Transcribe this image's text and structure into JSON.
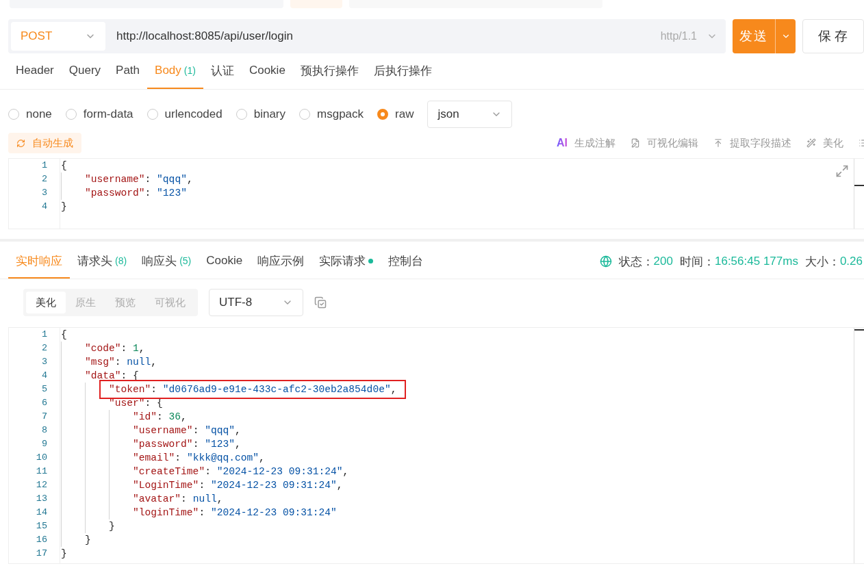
{
  "request": {
    "method": "POST",
    "url": "http://localhost:8085/api/user/login",
    "protocol": "http/1.1",
    "send": "发送",
    "save": "保 存"
  },
  "request_tabs": [
    {
      "label": "Header",
      "selected": false
    },
    {
      "label": "Query",
      "selected": false
    },
    {
      "label": "Path",
      "selected": false
    },
    {
      "label": "Body",
      "count": "(1)",
      "selected": true
    },
    {
      "label": "认证",
      "selected": false
    },
    {
      "label": "Cookie",
      "selected": false
    },
    {
      "label": "预执行操作",
      "selected": false
    },
    {
      "label": "后执行操作",
      "selected": false
    }
  ],
  "body_types": [
    {
      "label": "none",
      "selected": false
    },
    {
      "label": "form-data",
      "selected": false
    },
    {
      "label": "urlencoded",
      "selected": false
    },
    {
      "label": "binary",
      "selected": false
    },
    {
      "label": "msgpack",
      "selected": false
    },
    {
      "label": "raw",
      "selected": true
    }
  ],
  "format": "json",
  "auto_button": "自动生成",
  "body_tools": [
    {
      "kind": "ai",
      "badge": "AI",
      "label": "生成注解"
    },
    {
      "kind": "edit",
      "label": "可视化编辑"
    },
    {
      "kind": "extract",
      "label": "提取字段描述"
    },
    {
      "kind": "beautify",
      "label": "美化"
    }
  ],
  "request_body": [
    {
      "no": "1",
      "code": "{"
    },
    {
      "no": "2",
      "code": "    \"username\": \"qqq\","
    },
    {
      "no": "3",
      "code": "    \"password\": \"123\""
    },
    {
      "no": "4",
      "code": "}"
    }
  ],
  "response_tabs": [
    {
      "label": "实时响应",
      "selected": true
    },
    {
      "label": "请求头",
      "count": "(8)",
      "selected": false
    },
    {
      "label": "响应头",
      "count": "(5)",
      "selected": false
    },
    {
      "label": "Cookie",
      "selected": false
    },
    {
      "label": "响应示例",
      "selected": false
    },
    {
      "label": "实际请求",
      "dot": true,
      "selected": false
    },
    {
      "label": "控制台",
      "selected": false
    }
  ],
  "status": [
    {
      "label": "状态：",
      "value": "200"
    },
    {
      "label": "时间：",
      "value": "16:56:45 177ms"
    },
    {
      "label": "大小：",
      "value": "0.26"
    }
  ],
  "view_modes": [
    {
      "label": "美化",
      "selected": true
    },
    {
      "label": "原生",
      "selected": false
    },
    {
      "label": "预览",
      "selected": false
    },
    {
      "label": "可视化",
      "selected": false
    }
  ],
  "encoding": "UTF-8",
  "response_body": [
    {
      "no": "1",
      "code": "{",
      "highlighted": false
    },
    {
      "no": "2",
      "code": "    \"code\": 1,",
      "highlighted": false
    },
    {
      "no": "3",
      "code": "    \"msg\": null,",
      "highlighted": false
    },
    {
      "no": "4",
      "code": "    \"data\": {",
      "highlighted": false
    },
    {
      "no": "5",
      "code": "        \"token\": \"d0676ad9-e91e-433c-afc2-30eb2a854d0e\",",
      "highlighted": true
    },
    {
      "no": "6",
      "code": "        \"user\": {",
      "highlighted": false
    },
    {
      "no": "7",
      "code": "            \"id\": 36,",
      "highlighted": false
    },
    {
      "no": "8",
      "code": "            \"username\": \"qqq\",",
      "highlighted": false
    },
    {
      "no": "9",
      "code": "            \"password\": \"123\",",
      "highlighted": false
    },
    {
      "no": "10",
      "code": "            \"email\": \"kkk@qq.com\",",
      "highlighted": false
    },
    {
      "no": "11",
      "code": "            \"createTime\": \"2024-12-23 09:31:24\",",
      "highlighted": false
    },
    {
      "no": "12",
      "code": "            \"LoginTime\": \"2024-12-23 09:31:24\",",
      "highlighted": false
    },
    {
      "no": "13",
      "code": "            \"avatar\": null,",
      "highlighted": false
    },
    {
      "no": "14",
      "code": "            \"loginTime\": \"2024-12-23 09:31:24\"",
      "highlighted": false
    },
    {
      "no": "15",
      "code": "        }",
      "highlighted": false
    },
    {
      "no": "16",
      "code": "    }",
      "highlighted": false
    },
    {
      "no": "17",
      "code": "}",
      "highlighted": false
    }
  ]
}
